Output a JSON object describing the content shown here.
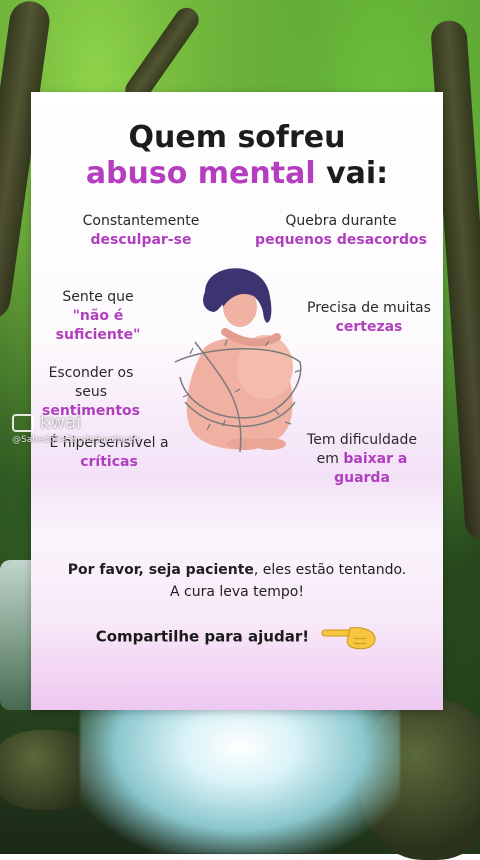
{
  "card": {
    "title_line1": "Quem sofreu",
    "title_line2_highlight": "abuso mental",
    "title_line2_rest": " vai:",
    "items": {
      "item1_text": "Constantemente",
      "item1_highlight": "desculpar-se",
      "item2_text": "Quebra durante",
      "item2_highlight": "pequenos desacordos",
      "item3_text": "Sente que",
      "item3_highlight": "\"não é suficiente\"",
      "item4_text": "Precisa de muitas",
      "item4_highlight": "certezas",
      "item5_text": "Esconder os seus",
      "item5_highlight": "sentimentos",
      "item6_text": "É hipersensível a",
      "item6_highlight": "críticas",
      "item7_text": "Tem dificuldade",
      "item7_prefix": "em ",
      "item7_highlight": "baixar a guarda"
    },
    "message": {
      "bold_part": "Por favor, seja paciente",
      "rest_part": ", eles estão tentando.",
      "line2": "A cura leva tempo!"
    },
    "share_label": "Compartilhe para ajudar!"
  },
  "watermark": {
    "brand": "kwai",
    "handle": "@SabedoriaSaudeSaudaveis"
  },
  "colors": {
    "accent": "#b53dc0",
    "text": "#1c1c1c"
  }
}
